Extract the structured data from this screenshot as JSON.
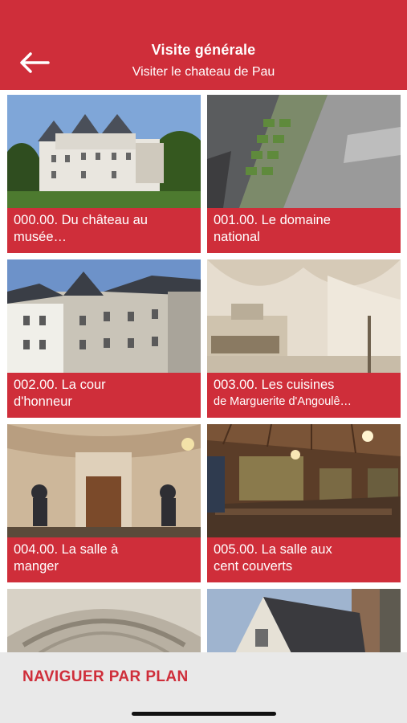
{
  "header": {
    "title": "Visite générale",
    "subtitle": "Visiter le chateau de Pau",
    "back_icon": "arrow-left-icon"
  },
  "cards": [
    {
      "line1": "000.00. Du château au",
      "line2": "musée…"
    },
    {
      "line1": "001.00. Le domaine",
      "line2": "national"
    },
    {
      "line1": "002.00. La cour",
      "line2": "d'honneur"
    },
    {
      "line1": "003.00. Les cuisines",
      "line2": "de Marguerite d'Angoulê…"
    },
    {
      "line1": "004.00. La salle à",
      "line2": "manger"
    },
    {
      "line1": "005.00. La salle aux",
      "line2": "cent couverts"
    }
  ],
  "footer": {
    "nav_label": "NAVIGUER PAR PLAN"
  },
  "colors": {
    "brand_red": "#cf2e3a",
    "footer_bg": "#e9e9e9"
  }
}
